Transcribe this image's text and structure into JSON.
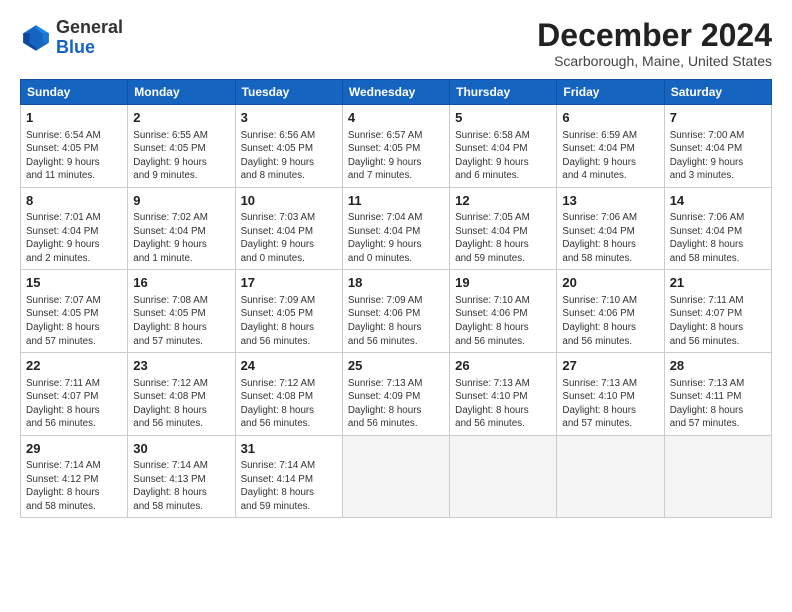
{
  "header": {
    "logo_general": "General",
    "logo_blue": "Blue",
    "month_title": "December 2024",
    "location": "Scarborough, Maine, United States"
  },
  "days_of_week": [
    "Sunday",
    "Monday",
    "Tuesday",
    "Wednesday",
    "Thursday",
    "Friday",
    "Saturday"
  ],
  "weeks": [
    [
      {
        "day": "1",
        "info": "Sunrise: 6:54 AM\nSunset: 4:05 PM\nDaylight: 9 hours\nand 11 minutes."
      },
      {
        "day": "2",
        "info": "Sunrise: 6:55 AM\nSunset: 4:05 PM\nDaylight: 9 hours\nand 9 minutes."
      },
      {
        "day": "3",
        "info": "Sunrise: 6:56 AM\nSunset: 4:05 PM\nDaylight: 9 hours\nand 8 minutes."
      },
      {
        "day": "4",
        "info": "Sunrise: 6:57 AM\nSunset: 4:05 PM\nDaylight: 9 hours\nand 7 minutes."
      },
      {
        "day": "5",
        "info": "Sunrise: 6:58 AM\nSunset: 4:04 PM\nDaylight: 9 hours\nand 6 minutes."
      },
      {
        "day": "6",
        "info": "Sunrise: 6:59 AM\nSunset: 4:04 PM\nDaylight: 9 hours\nand 4 minutes."
      },
      {
        "day": "7",
        "info": "Sunrise: 7:00 AM\nSunset: 4:04 PM\nDaylight: 9 hours\nand 3 minutes."
      }
    ],
    [
      {
        "day": "8",
        "info": "Sunrise: 7:01 AM\nSunset: 4:04 PM\nDaylight: 9 hours\nand 2 minutes."
      },
      {
        "day": "9",
        "info": "Sunrise: 7:02 AM\nSunset: 4:04 PM\nDaylight: 9 hours\nand 1 minute."
      },
      {
        "day": "10",
        "info": "Sunrise: 7:03 AM\nSunset: 4:04 PM\nDaylight: 9 hours\nand 0 minutes."
      },
      {
        "day": "11",
        "info": "Sunrise: 7:04 AM\nSunset: 4:04 PM\nDaylight: 9 hours\nand 0 minutes."
      },
      {
        "day": "12",
        "info": "Sunrise: 7:05 AM\nSunset: 4:04 PM\nDaylight: 8 hours\nand 59 minutes."
      },
      {
        "day": "13",
        "info": "Sunrise: 7:06 AM\nSunset: 4:04 PM\nDaylight: 8 hours\nand 58 minutes."
      },
      {
        "day": "14",
        "info": "Sunrise: 7:06 AM\nSunset: 4:04 PM\nDaylight: 8 hours\nand 58 minutes."
      }
    ],
    [
      {
        "day": "15",
        "info": "Sunrise: 7:07 AM\nSunset: 4:05 PM\nDaylight: 8 hours\nand 57 minutes."
      },
      {
        "day": "16",
        "info": "Sunrise: 7:08 AM\nSunset: 4:05 PM\nDaylight: 8 hours\nand 57 minutes."
      },
      {
        "day": "17",
        "info": "Sunrise: 7:09 AM\nSunset: 4:05 PM\nDaylight: 8 hours\nand 56 minutes."
      },
      {
        "day": "18",
        "info": "Sunrise: 7:09 AM\nSunset: 4:06 PM\nDaylight: 8 hours\nand 56 minutes."
      },
      {
        "day": "19",
        "info": "Sunrise: 7:10 AM\nSunset: 4:06 PM\nDaylight: 8 hours\nand 56 minutes."
      },
      {
        "day": "20",
        "info": "Sunrise: 7:10 AM\nSunset: 4:06 PM\nDaylight: 8 hours\nand 56 minutes."
      },
      {
        "day": "21",
        "info": "Sunrise: 7:11 AM\nSunset: 4:07 PM\nDaylight: 8 hours\nand 56 minutes."
      }
    ],
    [
      {
        "day": "22",
        "info": "Sunrise: 7:11 AM\nSunset: 4:07 PM\nDaylight: 8 hours\nand 56 minutes."
      },
      {
        "day": "23",
        "info": "Sunrise: 7:12 AM\nSunset: 4:08 PM\nDaylight: 8 hours\nand 56 minutes."
      },
      {
        "day": "24",
        "info": "Sunrise: 7:12 AM\nSunset: 4:08 PM\nDaylight: 8 hours\nand 56 minutes."
      },
      {
        "day": "25",
        "info": "Sunrise: 7:13 AM\nSunset: 4:09 PM\nDaylight: 8 hours\nand 56 minutes."
      },
      {
        "day": "26",
        "info": "Sunrise: 7:13 AM\nSunset: 4:10 PM\nDaylight: 8 hours\nand 56 minutes."
      },
      {
        "day": "27",
        "info": "Sunrise: 7:13 AM\nSunset: 4:10 PM\nDaylight: 8 hours\nand 57 minutes."
      },
      {
        "day": "28",
        "info": "Sunrise: 7:13 AM\nSunset: 4:11 PM\nDaylight: 8 hours\nand 57 minutes."
      }
    ],
    [
      {
        "day": "29",
        "info": "Sunrise: 7:14 AM\nSunset: 4:12 PM\nDaylight: 8 hours\nand 58 minutes."
      },
      {
        "day": "30",
        "info": "Sunrise: 7:14 AM\nSunset: 4:13 PM\nDaylight: 8 hours\nand 58 minutes."
      },
      {
        "day": "31",
        "info": "Sunrise: 7:14 AM\nSunset: 4:14 PM\nDaylight: 8 hours\nand 59 minutes."
      },
      {
        "day": "",
        "info": ""
      },
      {
        "day": "",
        "info": ""
      },
      {
        "day": "",
        "info": ""
      },
      {
        "day": "",
        "info": ""
      }
    ]
  ]
}
